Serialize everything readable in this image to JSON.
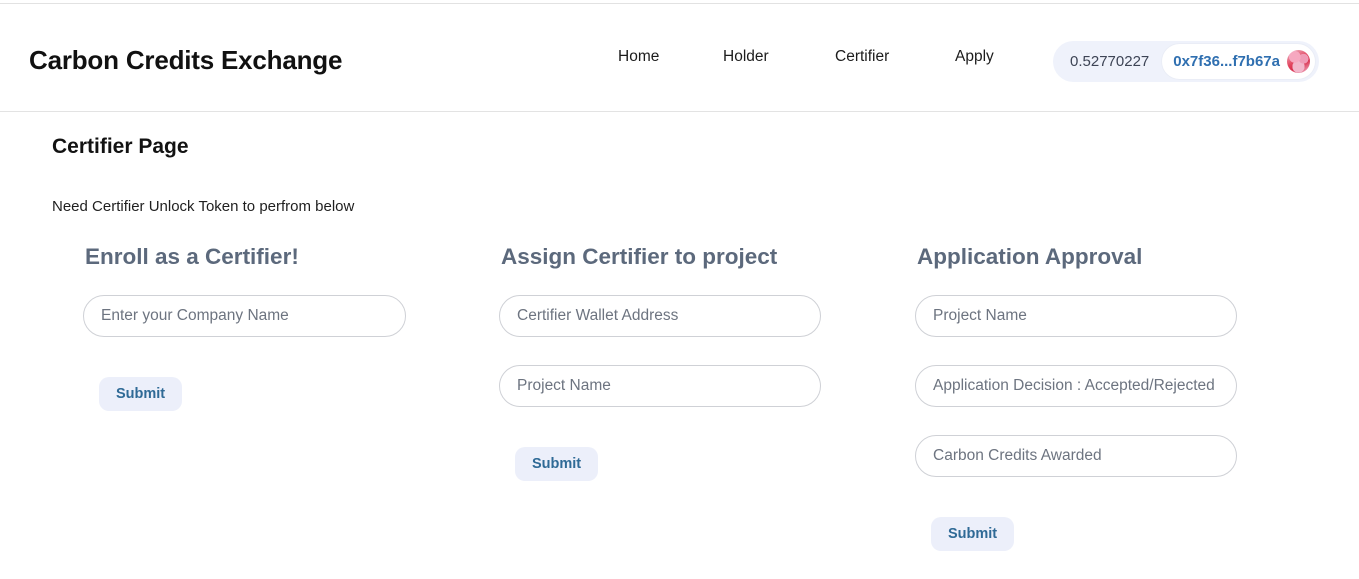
{
  "header": {
    "brand": "Carbon Credits Exchange",
    "nav": [
      {
        "label": "Home"
      },
      {
        "label": "Holder"
      },
      {
        "label": "Certifier"
      },
      {
        "label": "Apply"
      }
    ],
    "wallet": {
      "balance": "0.52770227",
      "address": "0x7f36...f7b67a",
      "avatar_icon": "wallet-avatar-icon",
      "badge_bg": "#eff2fb",
      "address_color": "#2f6fb0"
    }
  },
  "main": {
    "title": "Certifier Page",
    "subtitle": "Need Certifier Unlock Token to perfrom below",
    "columns": [
      {
        "title": "Enroll as a Certifier!",
        "fields": [
          {
            "name": "company-name-input",
            "placeholder": "Enter your Company Name",
            "value": ""
          }
        ],
        "submit_label": "Submit"
      },
      {
        "title": "Assign Certifier to project",
        "fields": [
          {
            "name": "certifier-wallet-address-input",
            "placeholder": "Certifier Wallet Address",
            "value": ""
          },
          {
            "name": "project-name-input",
            "placeholder": "Project Name",
            "value": ""
          }
        ],
        "submit_label": "Submit"
      },
      {
        "title": "Application Approval",
        "fields": [
          {
            "name": "approval-project-name-input",
            "placeholder": "Project Name",
            "value": ""
          },
          {
            "name": "application-decision-input",
            "placeholder": "Application Decision : Accepted/Rejected",
            "value": ""
          },
          {
            "name": "carbon-credits-awarded-input",
            "placeholder": "Carbon Credits Awarded",
            "value": ""
          }
        ],
        "submit_label": "Submit"
      }
    ]
  },
  "theme": {
    "heading_color": "#5c697c",
    "submit_bg": "#eceffa",
    "submit_text": "#2f6a96",
    "field_border": "#cfd1d6",
    "placeholder_color": "#6d7480"
  }
}
